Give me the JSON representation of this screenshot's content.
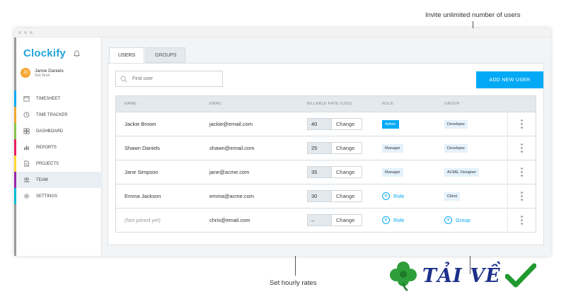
{
  "annotations": {
    "top": "Invite unlimited number of users",
    "bottom": "Set hourly rates"
  },
  "app": {
    "logo": "Clockify"
  },
  "user": {
    "initials": "JD",
    "name": "Jamie Daniels",
    "org": "Sol-Tech"
  },
  "sidebar": {
    "items": [
      {
        "label": "TIMESHEET",
        "icon": "timesheet-icon",
        "accent": "#03a9f4"
      },
      {
        "label": "TIME TRACKER",
        "icon": "clock-icon",
        "accent": "#f4a731"
      },
      {
        "label": "DASHBOARD",
        "icon": "dashboard-icon",
        "accent": "#8bc34a"
      },
      {
        "label": "REPORTS",
        "icon": "reports-icon",
        "accent": "#e91e63"
      },
      {
        "label": "PROJECTS",
        "icon": "projects-icon",
        "accent": "#fdd835"
      },
      {
        "label": "TEAM",
        "icon": "team-icon",
        "accent": "#9c27b0"
      },
      {
        "label": "SETTINGS",
        "icon": "settings-icon",
        "accent": "#00bcd4"
      }
    ]
  },
  "tabs": [
    {
      "label": "USERS"
    },
    {
      "label": "GROUPS"
    }
  ],
  "search": {
    "placeholder": "Find user"
  },
  "add_user_label": "ADD NEW USER",
  "table": {
    "headers": [
      "NAME",
      "EMAIL",
      "BILLABLE RATE (USD)",
      "ROLE",
      "GROUP"
    ],
    "change_label": "Change",
    "role_add_label": "Role",
    "group_add_label": "Group",
    "rows": [
      {
        "name": "Jackie Brown",
        "email": "jackie@email.com",
        "rate": "40",
        "role": "Admin",
        "group": "Developer"
      },
      {
        "name": "Shawn Daniels",
        "email": "shawn@email.com",
        "rate": "25",
        "role": "Manager",
        "group": "Developer"
      },
      {
        "name": "Jane Simpson",
        "email": "jane@acme.com",
        "rate": "35",
        "role": "Manager",
        "group": "ACME, Designer"
      },
      {
        "name": "Emma Jackson",
        "email": "emma@acme.com",
        "rate": "30",
        "role": "",
        "group": "Client"
      },
      {
        "name": "(Not joined yet)",
        "email": "chris@email.com",
        "rate": "–",
        "role": "",
        "group": ""
      }
    ]
  },
  "watermark": {
    "text": "TẢI VỀ"
  },
  "colors": {
    "brand": "#03a9f4",
    "logo": "#21a4db",
    "table_header_bg": "#e4e9ed"
  }
}
